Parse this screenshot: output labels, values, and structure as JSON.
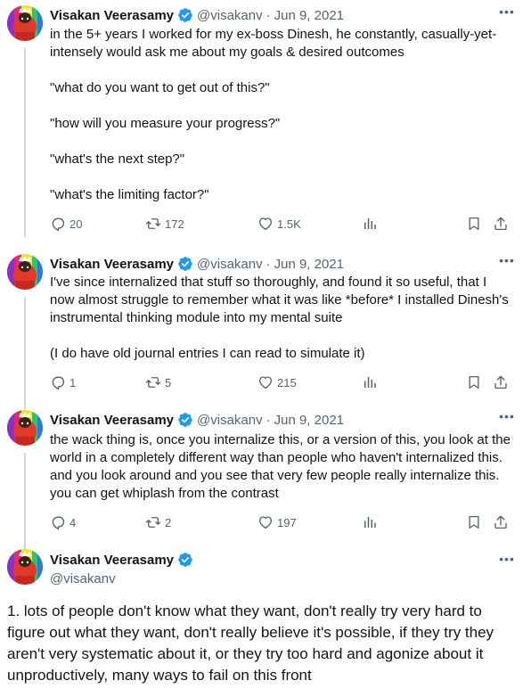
{
  "tweets": [
    {
      "name": "Visakan Veerasamy",
      "handle": "@visakanv",
      "dot": "·",
      "date": "Jun 9, 2021",
      "paragraphs": [
        "in the 5+ years I worked for my ex-boss Dinesh, he constantly, casually-yet-intensely would ask me about my goals & desired outcomes",
        "\"what do you want to get out of this?\"",
        "\"how will you measure your progress?\"",
        "\"what's the next step?\"",
        "\"what's the limiting factor?\""
      ],
      "replies": "20",
      "retweets": "172",
      "likes": "1.5K"
    },
    {
      "name": "Visakan Veerasamy",
      "handle": "@visakanv",
      "dot": "·",
      "date": "Jun 9, 2021",
      "paragraphs": [
        "I've since internalized that stuff so thoroughly, and found it so useful, that I now almost struggle to remember what it was like *before* I installed Dinesh's instrumental thinking module into my mental suite",
        "(I do have old journal entries I can read to simulate it)"
      ],
      "replies": "1",
      "retweets": "5",
      "likes": "215"
    },
    {
      "name": "Visakan Veerasamy",
      "handle": "@visakanv",
      "dot": "·",
      "date": "Jun 9, 2021",
      "paragraphs": [
        "the wack thing is, once you internalize this, or a version of this, you look at the world in a completely different way than people who haven't internalized this. and you look around and you see that very few people really internalize this. you can get whiplash from the contrast"
      ],
      "replies": "4",
      "retweets": "2",
      "likes": "197"
    }
  ],
  "main_tweet": {
    "name": "Visakan Veerasamy",
    "handle": "@visakanv",
    "text": "1. lots of people don't know what they want, don't really try very hard to figure out what they want, don't really believe it's possible, if they try they aren't very systematic about it, or they try too hard and agonize about it unproductively, many ways to fail on this front"
  },
  "icons": {
    "more": "more-icon",
    "verified": "verified-badge-icon",
    "reply": "reply-icon",
    "retweet": "retweet-icon",
    "like": "heart-icon",
    "views": "views-icon",
    "bookmark": "bookmark-icon",
    "share": "share-icon"
  },
  "colors": {
    "verified": "#1d9bf0",
    "text": "#0f1419",
    "secondary": "#536471"
  }
}
